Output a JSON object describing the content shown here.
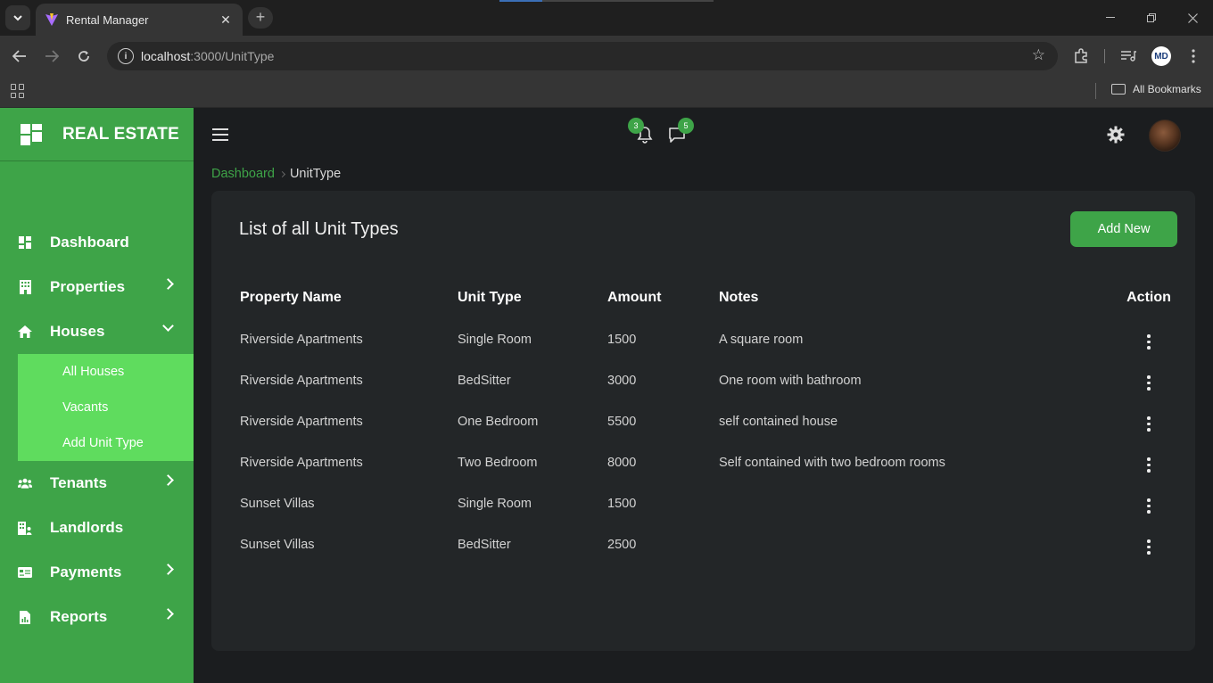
{
  "browser": {
    "tab_title": "Rental Manager",
    "tab_close": "✕",
    "new_tab": "+",
    "url_host": "localhost",
    "url_path": ":3000/UnitType",
    "bookmarks_label": "All Bookmarks",
    "profile_initials": "MD"
  },
  "sidebar": {
    "brand": "REAL ESTATE",
    "items": [
      {
        "label": "Dashboard",
        "icon": "dashboard-icon"
      },
      {
        "label": "Properties",
        "icon": "building-icon"
      },
      {
        "label": "Houses",
        "icon": "home-icon"
      },
      {
        "label": "Tenants",
        "icon": "users-icon"
      },
      {
        "label": "Landlords",
        "icon": "landlord-icon"
      },
      {
        "label": "Payments",
        "icon": "payment-card-icon"
      },
      {
        "label": "Reports",
        "icon": "report-icon"
      }
    ],
    "houses_submenu": [
      "All Houses",
      "Vacants",
      "Add Unit Type"
    ]
  },
  "topbar": {
    "notifications_count": "3",
    "messages_count": "5"
  },
  "breadcrumb": {
    "link": "Dashboard",
    "current": "UnitType"
  },
  "main": {
    "title": "List of all Unit Types",
    "add_button": "Add New",
    "columns": [
      "Property Name",
      "Unit Type",
      "Amount",
      "Notes",
      "Action"
    ],
    "rows": [
      {
        "property": "Riverside Apartments",
        "unit_type": "Single Room",
        "amount": "1500",
        "notes": "A square room"
      },
      {
        "property": "Riverside Apartments",
        "unit_type": "BedSitter",
        "amount": "3000",
        "notes": "One room with bathroom"
      },
      {
        "property": "Riverside Apartments",
        "unit_type": "One Bedroom",
        "amount": "5500",
        "notes": "self contained house"
      },
      {
        "property": "Riverside Apartments",
        "unit_type": "Two Bedroom",
        "amount": "8000",
        "notes": "Self contained with two bedroom rooms"
      },
      {
        "property": "Sunset Villas",
        "unit_type": "Single Room",
        "amount": "1500",
        "notes": ""
      },
      {
        "property": "Sunset Villas",
        "unit_type": "BedSitter",
        "amount": "2500",
        "notes": ""
      }
    ]
  },
  "colors": {
    "accent": "#3ea448",
    "submenu": "#5fdc5e",
    "card": "#232628",
    "background": "#1b1d1f"
  }
}
